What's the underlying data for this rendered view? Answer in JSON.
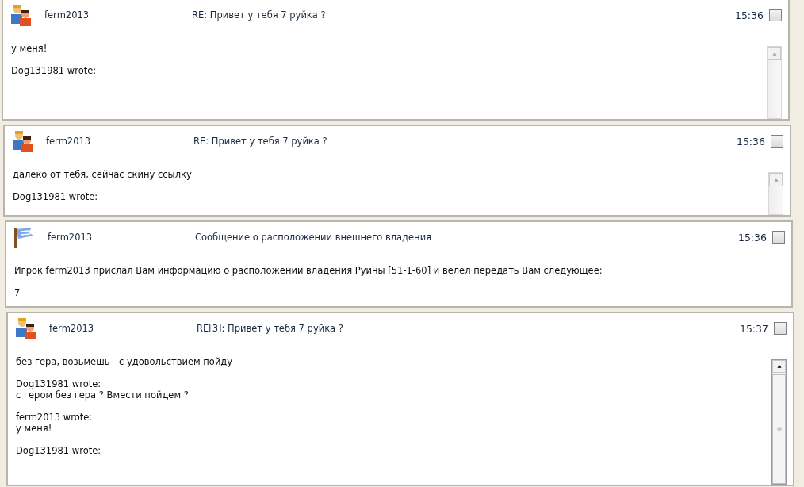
{
  "messages": [
    {
      "kind": "reply",
      "sender": "ferm2013",
      "subject": "RE: Привет у тебя 7 руйка ?",
      "time": "15:36",
      "checked": false,
      "scrollbar": {
        "disabled": true
      },
      "paragraphs": [
        [
          "у меня!"
        ],
        [
          "Dog131981 wrote:"
        ]
      ]
    },
    {
      "kind": "reply",
      "sender": "ferm2013",
      "subject": "RE: Привет у тебя 7 руйка ?",
      "time": "15:36",
      "checked": false,
      "scrollbar": {
        "disabled": true
      },
      "paragraphs": [
        [
          "далеко от тебя, сейчас скину ссылку"
        ],
        [
          "Dog131981 wrote:"
        ]
      ]
    },
    {
      "kind": "notice",
      "sender": "ferm2013",
      "subject": "Сообщение о расположении внешнего владения",
      "time": "15:36",
      "checked": false,
      "paragraphs": [
        [
          "Игрок ferm2013 прислал Вам информацию о расположении владения Руины [51-1-60] и велел передать Вам следующее:"
        ],
        [
          "7"
        ]
      ]
    },
    {
      "kind": "reply",
      "sender": "ferm2013",
      "subject": "RE[3]: Привет у тебя 7 руйка ?",
      "time": "15:37",
      "checked": false,
      "scrollbar": {
        "disabled": false
      },
      "paragraphs": [
        [
          "без гера, возьмешь - с удовольствием пойду"
        ],
        [
          "Dog131981 wrote:",
          "с гером без гера ? Вмести пойдем ?"
        ],
        [
          "ferm2013 wrote:",
          "у меня!"
        ],
        [
          "Dog131981 wrote:"
        ]
      ]
    }
  ]
}
